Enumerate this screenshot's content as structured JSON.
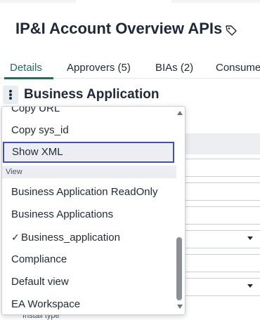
{
  "header": {
    "title": "IP&I Account Overview APIs",
    "tag_icon": "tag-icon"
  },
  "tabs": [
    {
      "label": "Details",
      "active": true
    },
    {
      "label": "Approvers (5)",
      "active": false
    },
    {
      "label": "BIAs (2)",
      "active": false
    },
    {
      "label": "Consume",
      "active": false
    }
  ],
  "section": {
    "title": "Business Application",
    "menu_icon": "more-vertical-icon"
  },
  "form": {
    "install_type_label": "Install type"
  },
  "menu": {
    "items_top": [
      {
        "label": "Copy URL"
      },
      {
        "label": "Copy sys_id"
      },
      {
        "label": "Show XML",
        "focused": true
      }
    ],
    "view_group_label": "View",
    "view_items": [
      {
        "label": "Business Application ReadOnly"
      },
      {
        "label": "Business Applications"
      },
      {
        "label": "Business_application",
        "checked": true
      },
      {
        "label": "Compliance"
      },
      {
        "label": "Default view"
      },
      {
        "label": "EA Workspace"
      }
    ],
    "check_glyph": "✓"
  },
  "colors": {
    "accent_green": "#1f6f5c",
    "focus_border": "#3f51b5"
  }
}
